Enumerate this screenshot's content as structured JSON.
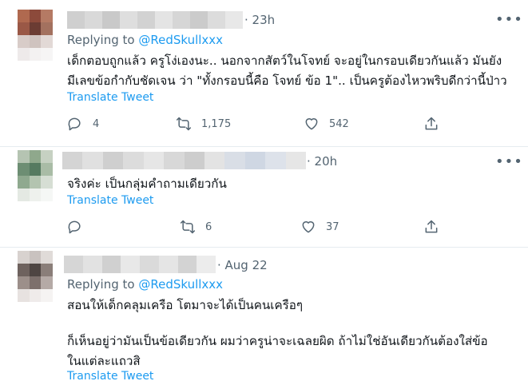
{
  "tweets": [
    {
      "time": "· 23h",
      "replying_prefix": "Replying to ",
      "replying_handle": "@RedSkullxxx",
      "lines": [
        "เด็กตอบถูกแล้ว ครูโง่เองนะ.. นอกจากสัตว์ในโจทย์ จะอยู่ในกรอบเดียวกันแล้ว มันยัง",
        "มีเลขข้อกำกับชัดเจน ว่า \"ทั้งกรอบนี้คือ โจทย์ ข้อ 1\".. เป็นครูต้องไหวพริบดีกว่านี้ป่าว"
      ],
      "translate": "Translate Tweet",
      "reply_count": "4",
      "retweet_count": "1,175",
      "like_count": "542"
    },
    {
      "time": "· 20h",
      "lines": [
        "จริงค่ะ เป็นกลุ่มคำถามเดียวกัน"
      ],
      "translate": "Translate Tweet",
      "reply_count": "",
      "retweet_count": "6",
      "like_count": "37"
    },
    {
      "time": "· Aug 22",
      "replying_prefix": "Replying to ",
      "replying_handle": "@RedSkullxxx",
      "lines": [
        "สอนให้เด็กคลุมเครือ โตมาจะได้เป็นคนเครือๆ",
        "",
        "ก็เห็นอยู่ว่ามันเป็นข้อเดียวกัน ผมว่าครูน่าจะเฉลยผิด  ถ้าไม่ใช่อันเดียวกันต้องใส่ข้อ",
        "ในแต่ละแถวสิ"
      ],
      "translate": "Translate Tweet"
    }
  ],
  "icons": {
    "more": "more-horizontal-icon",
    "reply": "reply-icon",
    "retweet": "retweet-icon",
    "like": "heart-icon",
    "share": "share-icon"
  },
  "colors": {
    "accent": "#1d9bf0",
    "secondary_text": "#536471",
    "divider": "#e6ecf0"
  }
}
